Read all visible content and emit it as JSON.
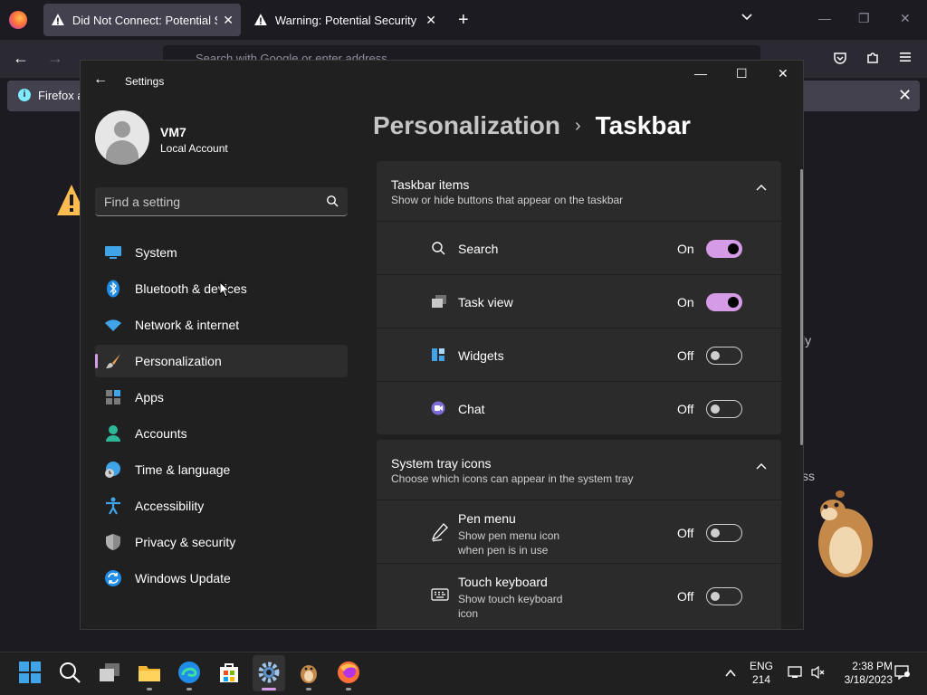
{
  "browser": {
    "tabs": [
      {
        "title": "Did Not Connect: Potential Security Issue",
        "active": true
      },
      {
        "title": "Warning: Potential Security Risk Ahead",
        "active": false
      }
    ],
    "url_placeholder": "Search with Google or enter address",
    "infobar_text": "Firefox a",
    "background_texts": [
      "ly",
      "ss"
    ],
    "icons": {
      "new_tab": "plus-icon",
      "tab_list": "chevron-down-icon",
      "pocket": "pocket-icon",
      "extensions": "puzzle-icon",
      "menu": "hamburger-icon"
    }
  },
  "settings": {
    "app_title": "Settings",
    "account": {
      "name": "VM7",
      "type": "Local Account"
    },
    "search": {
      "placeholder": "Find a setting"
    },
    "nav": [
      {
        "label": "System",
        "icon": "monitor-icon"
      },
      {
        "label": "Bluetooth & devices",
        "icon": "bluetooth-icon"
      },
      {
        "label": "Network & internet",
        "icon": "wifi-icon"
      },
      {
        "label": "Personalization",
        "icon": "brush-icon",
        "selected": true
      },
      {
        "label": "Apps",
        "icon": "apps-icon"
      },
      {
        "label": "Accounts",
        "icon": "person-icon"
      },
      {
        "label": "Time & language",
        "icon": "globe-clock-icon"
      },
      {
        "label": "Accessibility",
        "icon": "accessibility-icon"
      },
      {
        "label": "Privacy & security",
        "icon": "shield-icon"
      },
      {
        "label": "Windows Update",
        "icon": "update-icon"
      }
    ],
    "breadcrumb": {
      "parent": "Personalization",
      "current": "Taskbar"
    },
    "sections": [
      {
        "title": "Taskbar items",
        "description": "Show or hide buttons that appear on the taskbar",
        "items": [
          {
            "label": "Search",
            "state": "On",
            "on": true,
            "icon": "search-icon"
          },
          {
            "label": "Task view",
            "state": "On",
            "on": true,
            "icon": "task-view-icon"
          },
          {
            "label": "Widgets",
            "state": "Off",
            "on": false,
            "icon": "widgets-icon"
          },
          {
            "label": "Chat",
            "state": "Off",
            "on": false,
            "icon": "chat-icon"
          }
        ]
      },
      {
        "title": "System tray icons",
        "description": "Choose which icons can appear in the system tray",
        "items": [
          {
            "label": "Pen menu",
            "description": "Show pen menu icon when pen is in use",
            "state": "Off",
            "on": false,
            "icon": "pen-icon"
          },
          {
            "label": "Touch keyboard",
            "description": "Show touch keyboard icon",
            "state": "Off",
            "on": false,
            "icon": "keyboard-icon"
          }
        ]
      }
    ],
    "accent_color": "#d69be7"
  },
  "taskbar": {
    "apps": [
      "start-icon",
      "search-icon",
      "task-view-icon",
      "file-explorer-icon",
      "edge-icon",
      "store-icon",
      "settings-icon",
      "hamster-icon",
      "firefox-icon"
    ],
    "language": "ENG",
    "language_sub": "214",
    "time": "2:38 PM",
    "date": "3/18/2023"
  }
}
